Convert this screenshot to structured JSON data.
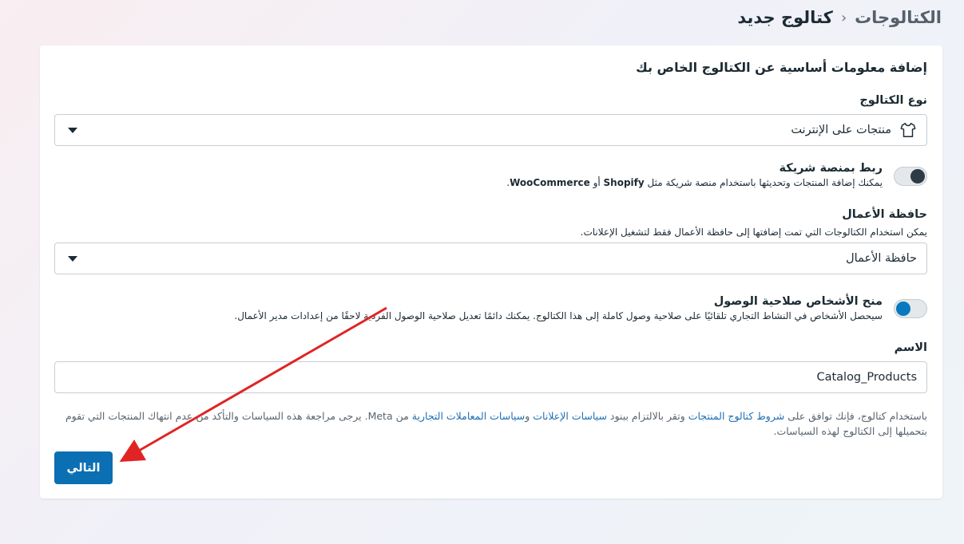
{
  "breadcrumb": {
    "root": "الكتالوجات",
    "separator": "›",
    "current": "كتالوج جديد"
  },
  "form": {
    "title": "إضافة معلومات أساسية عن الكتالوج الخاص بك",
    "catalog_type": {
      "label": "نوع الكتالوج",
      "value": "منتجات على الإنترنت",
      "icon": "shirt-icon"
    },
    "partner": {
      "title": "ربط بمنصة شريكة",
      "desc_prefix": "يمكنك إضافة المنتجات وتحديثها باستخدام منصة شريكة مثل ",
      "shopify": "Shopify",
      "or": " أو ",
      "woocommerce": "WooCommerce",
      "end": ".",
      "enabled": false
    },
    "portfolio": {
      "label": "حافظة الأعمال",
      "help": "يمكن استخدام الكتالوجات التي تمت إضافتها إلى حافظة الأعمال فقط لتشغيل الإعلانات.",
      "value": "حافظة الأعمال"
    },
    "access": {
      "title": "منح الأشخاص صلاحية الوصول",
      "desc": "سيحصل الأشخاص في النشاط التجاري تلقائيًا على صلاحية وصول كاملة إلى هذا الكتالوج. يمكنك دائمًا تعديل صلاحية الوصول الفردية لاحقًا من إعدادات مدير الأعمال.",
      "enabled": true
    },
    "name": {
      "label": "الاسم",
      "value": "Catalog_Products"
    },
    "terms": {
      "t1": "باستخدام كتالوج، فإنك توافق على ",
      "link1": "شروط كتالوج المنتجات",
      "t2": " وتقر بالالتزام ببنود ",
      "link2": "سياسات الإعلانات",
      "t3": " و",
      "link3": "سياسات المعاملات التجارية",
      "t4": " من Meta. يرجى مراجعة هذه السياسات والتأكد من عدم انتهاك المنتجات التي تقوم بتحميلها إلى الكتالوج لهذه السياسات."
    },
    "next_label": "التالي"
  },
  "colors": {
    "primary": "#0a6fb3",
    "toggle_on": "#0a78be",
    "arrow": "#e02424"
  }
}
